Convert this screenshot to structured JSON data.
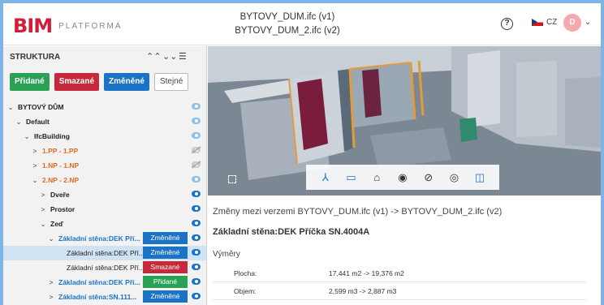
{
  "header": {
    "logo_mark": "BIM",
    "logo_text": "PLATFORMA",
    "title_line1": "BYTOVY_DUM.ifc (v1)",
    "title_line2": "BYTOVY_DUM_2.ifc (v2)",
    "help_icon": "?",
    "language": "CZ",
    "avatar_initial": "D",
    "avatar_caret": "⌄"
  },
  "structure": {
    "title": "STRUKTURA",
    "controls": [
      "⌃⌃",
      "⌄⌄",
      "☰"
    ],
    "filters": {
      "added": "Přidané",
      "deleted": "Smazané",
      "changed": "Změněné",
      "same": "Stejné"
    },
    "tree": [
      {
        "chev": "⌄",
        "label": "BYTOVÝ DŮM"
      },
      {
        "chev": "⌄",
        "label": "Default"
      },
      {
        "chev": "⌄",
        "label": "IfcBuilding"
      },
      {
        "chev": ">",
        "label": "1.PP - 1.PP"
      },
      {
        "chev": ">",
        "label": "1.NP - 1.NP"
      },
      {
        "chev": "⌄",
        "label": "2.NP - 2.NP"
      },
      {
        "chev": ">",
        "label": "Dveře"
      },
      {
        "chev": ">",
        "label": "Prostor"
      },
      {
        "chev": "⌄",
        "label": "Zeď"
      },
      {
        "chev": "⌄",
        "label": "Základní stěna:DEK Pří...",
        "badge": "Změněné"
      },
      {
        "chev": "",
        "label": "Základní stěna:DEK Pří...",
        "badge": "Změněné"
      },
      {
        "chev": "",
        "label": "Základní stěna:DEK Pří...",
        "badge": "Smazané"
      },
      {
        "chev": ">",
        "label": "Základní stěna:DEK Pří...",
        "badge": "Přidané"
      },
      {
        "chev": ">",
        "label": "Základní stěna:SN.111...",
        "badge": "Změněné"
      }
    ]
  },
  "viewer": {
    "expand_icon": "expand-icon",
    "tools": [
      "⅄",
      "▭",
      "⌂",
      "◉",
      "⊘",
      "◎",
      "◫"
    ]
  },
  "details": {
    "title": "Změny mezi verzemi BYTOVY_DUM.ifc (v1) -> BYTOVY_DUM_2.ifc (v2)",
    "element": "Základní stěna:DEK Příčka SN.4004A",
    "section": "Výměry",
    "rows": [
      {
        "key": "Plocha:",
        "value": "17,441 m2 -> 19,376 m2"
      },
      {
        "key": "Objem:",
        "value": "2,599 m3 -> 2,887 m3"
      }
    ]
  },
  "colors": {
    "added": "#2aa155",
    "deleted": "#c62a3a",
    "changed": "#1b73c6",
    "brand": "#d11f3a"
  }
}
